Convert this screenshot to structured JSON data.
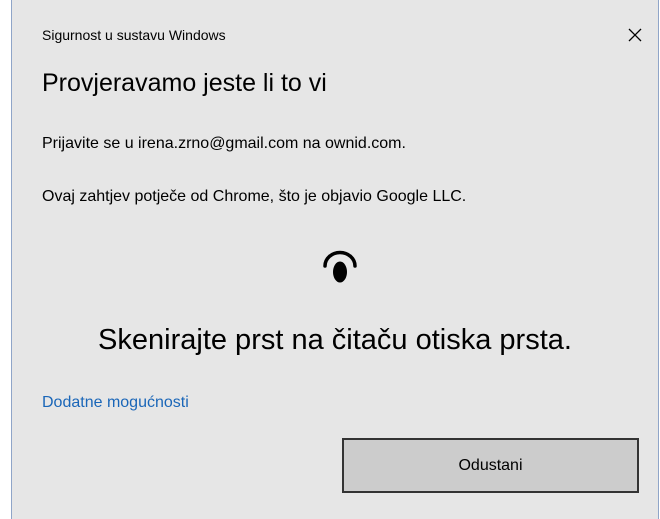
{
  "dialog": {
    "app_title": "Sigurnost u sustavu Windows",
    "heading": "Provjeravamo jeste li to vi",
    "sign_in_message": "Prijavite se u irena.zrno@gmail.com na ownid.com.",
    "request_origin": "Ovaj zahtjev potječe od Chrome, što je objavio Google LLC.",
    "instruction": "Skenirajte prst na čitaču otiska prsta.",
    "more_options_label": "Dodatne mogućnosti",
    "cancel_label": "Odustani",
    "icons": {
      "close": "close-icon",
      "fingerprint": "fingerprint-icon"
    }
  },
  "colors": {
    "background": "#e6e6e6",
    "link": "#1a66b8",
    "button_bg": "#cccccc",
    "button_border": "#333333"
  }
}
